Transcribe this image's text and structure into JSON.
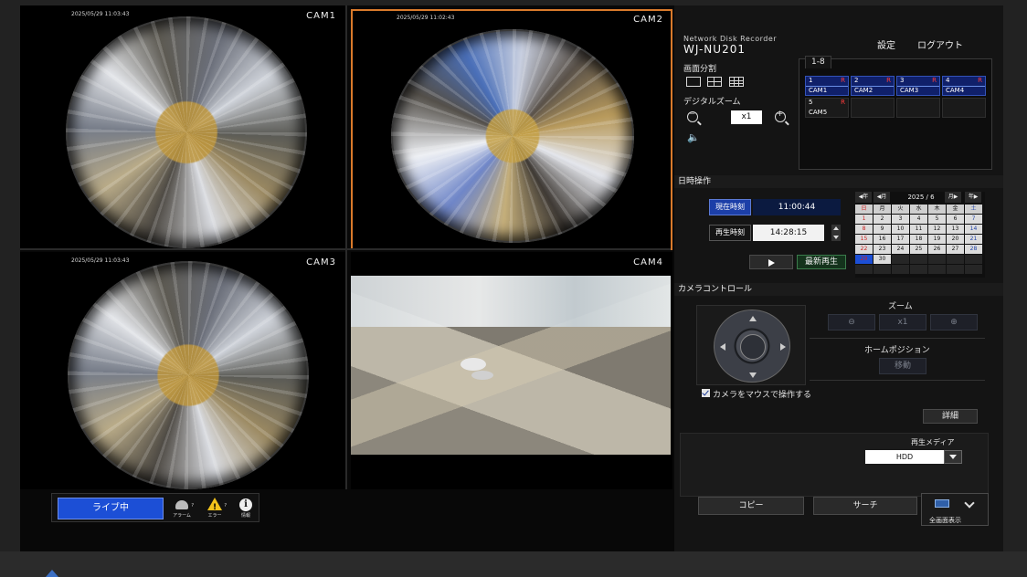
{
  "cameras": [
    {
      "label": "CAM1",
      "timestamp": "2025/05/29 11:03:43"
    },
    {
      "label": "CAM2",
      "timestamp": "2025/05/29 11:02:43"
    },
    {
      "label": "CAM3",
      "timestamp": "2025/05/29 11:03:43"
    },
    {
      "label": "CAM4",
      "timestamp": ""
    }
  ],
  "status": {
    "live_label": "ライブ中",
    "alarm_label": "アラーム",
    "error_label": "エラー",
    "info_label": "情報",
    "alarm_count": "?",
    "error_count": "?"
  },
  "header": {
    "subtitle": "Network Disk Recorder",
    "model": "WJ-NU201",
    "settings_label": "設定",
    "logout_label": "ログアウト"
  },
  "screen_split": {
    "label": "画面分割"
  },
  "digital_zoom": {
    "label": "デジタルズーム",
    "value": "x1"
  },
  "channels": {
    "tab_label": "1-8",
    "items": [
      {
        "num": "1",
        "name": "CAM1",
        "rec": "R"
      },
      {
        "num": "2",
        "name": "CAM2",
        "rec": "R"
      },
      {
        "num": "3",
        "name": "CAM3",
        "rec": "R"
      },
      {
        "num": "4",
        "name": "CAM4",
        "rec": "R"
      },
      {
        "num": "5",
        "name": "CAM5",
        "rec": "R"
      }
    ]
  },
  "datetime": {
    "section_label": "日時操作",
    "current_label": "現在時刻",
    "current_value": "11:00:44",
    "playback_label": "再生時刻",
    "playback_value": "14:28:15",
    "latest_play_label": "最新再生"
  },
  "calendar": {
    "prev_year": "◀年",
    "prev_month": "◀月",
    "title": "2025 / 6",
    "next_month": "月▶",
    "next_year": "年▶",
    "weekdays": [
      "日",
      "月",
      "火",
      "水",
      "木",
      "金",
      "土"
    ],
    "days": [
      "1",
      "2",
      "3",
      "4",
      "5",
      "6",
      "7",
      "8",
      "9",
      "10",
      "11",
      "12",
      "13",
      "14",
      "15",
      "16",
      "17",
      "18",
      "19",
      "20",
      "21",
      "22",
      "23",
      "24",
      "25",
      "26",
      "27",
      "28",
      "29",
      "30"
    ],
    "today": "29"
  },
  "camera_control": {
    "section_label": "カメラコントロール",
    "zoom_label": "ズーム",
    "zoom_value": "x1",
    "home_label": "ホームポジション",
    "move_label": "移動",
    "mouse_control_label": "カメラをマウスで操作する",
    "details_label": "詳細"
  },
  "media": {
    "label": "再生メディア",
    "value": "HDD"
  },
  "actions": {
    "copy_label": "コピー",
    "search_label": "サーチ",
    "fullscreen_label": "全画面表示"
  }
}
